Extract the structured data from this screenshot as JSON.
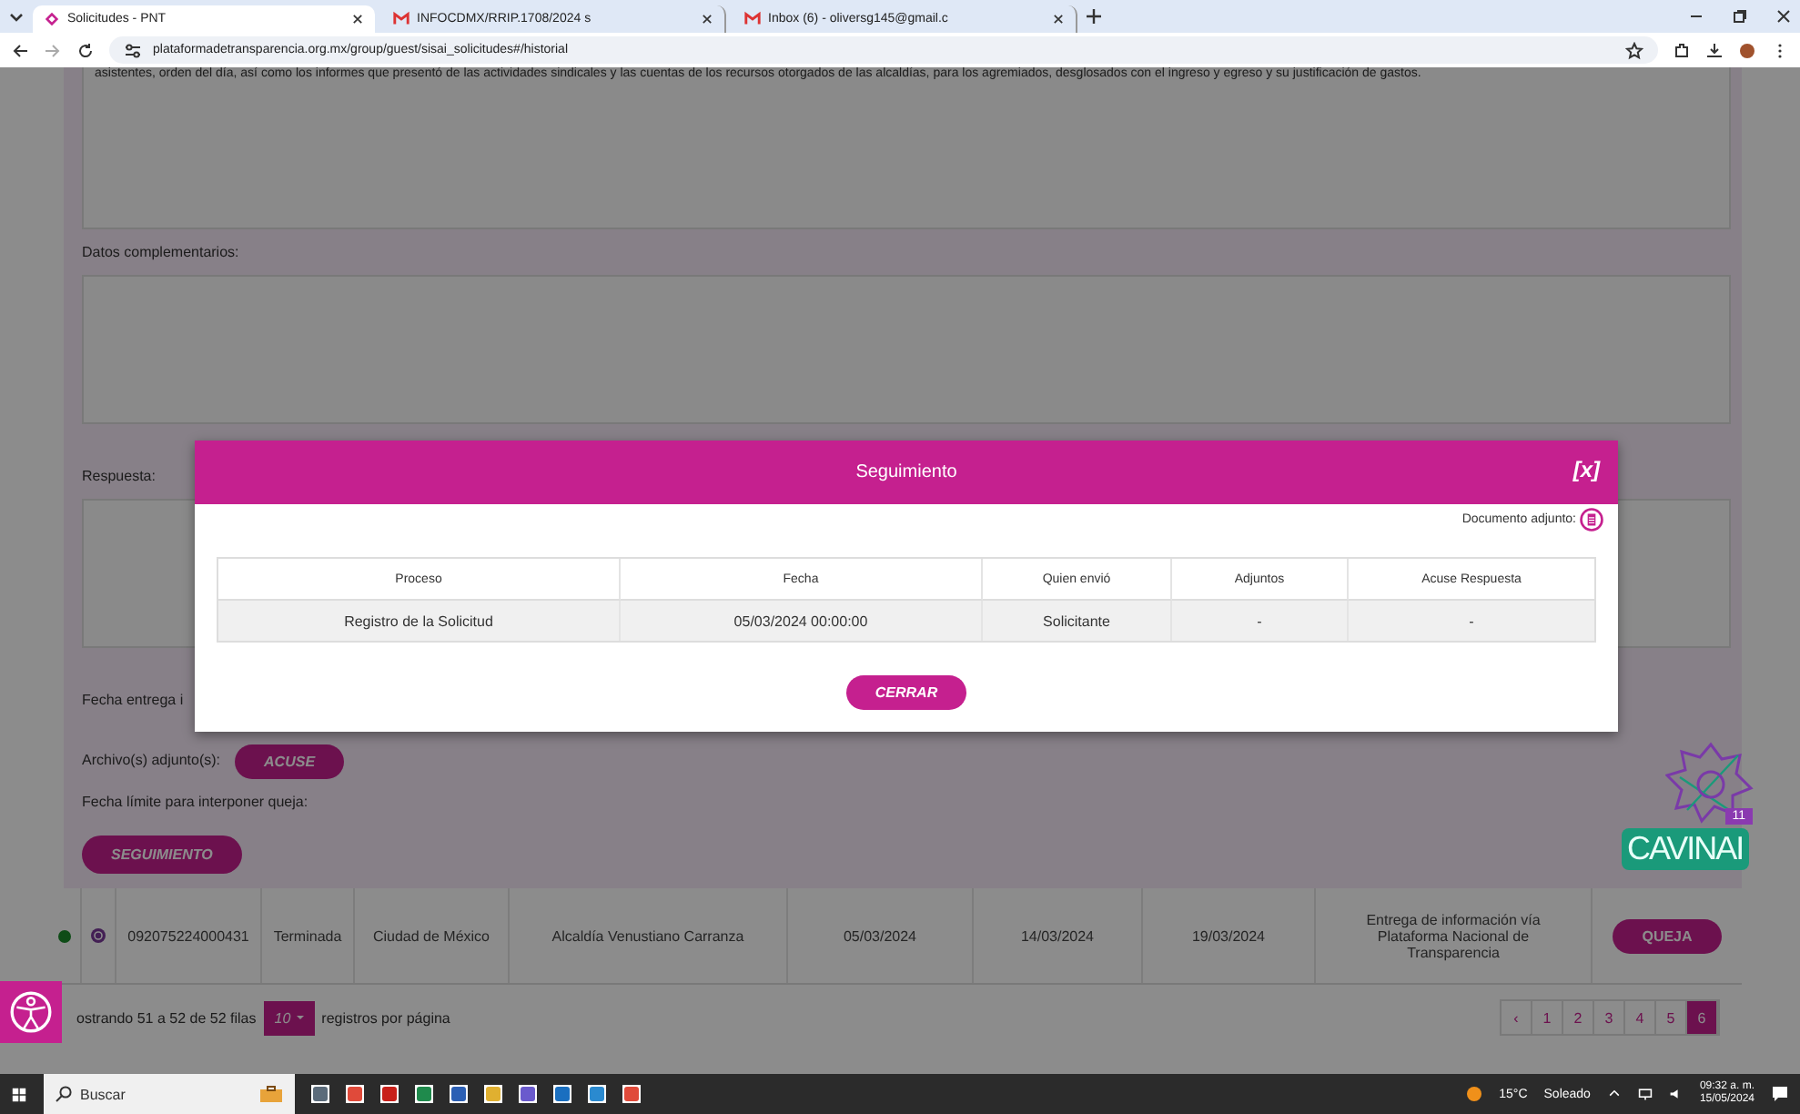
{
  "browser": {
    "tabs": [
      {
        "title": "Solicitudes - PNT",
        "selected": true
      },
      {
        "title": "INFOCDMX/RRIP.1708/2024 s",
        "selected": false
      },
      {
        "title": "Inbox (6) - oliversg145@gmail.c",
        "selected": false
      }
    ],
    "address": "plataformadetransparencia.org.mx/group/guest/sisai_solicitudes#/historial"
  },
  "form": {
    "top_text": "asistentes, orden del día, así como los informes que presentó de las actividades sindicales y las cuentas de los recursos otorgados de las alcaldías, para los agremiados, desglosados con el ingreso y egreso y su justificación de gastos.",
    "sections": [
      {
        "label": "Datos complementarios:"
      },
      {
        "label": "Respuesta:"
      }
    ],
    "delivery_label": "Fecha entrega i",
    "attachments_label": "Archivo(s) adjunto(s):",
    "attachments_button": "ACUSE",
    "deadline_label": "Fecha límite para interponer queja:",
    "followup_button": "SEGUIMIENTO"
  },
  "row": {
    "cells": [
      "092075224000431",
      "Terminada",
      "Ciudad de México",
      "Alcaldía Venustiano Carranza",
      "05/03/2024",
      "14/03/2024",
      "19/03/2024",
      "Entrega de información vía Plataforma Nacional de Transparencia"
    ],
    "button": "QUEJA"
  },
  "footer": {
    "showing": "ostrando 51 a 52 de 52 filas",
    "page_size": "10",
    "per_page": "registros por página",
    "pages": [
      {
        "label": "‹",
        "selected": false
      },
      {
        "label": "1",
        "selected": false
      },
      {
        "label": "2",
        "selected": false
      },
      {
        "label": "3",
        "selected": false
      },
      {
        "label": "4",
        "selected": false
      },
      {
        "label": "5",
        "selected": false
      },
      {
        "label": "6",
        "selected": true
      }
    ]
  },
  "modal": {
    "title": "Seguimiento",
    "close": "[x]",
    "attachment_label": "Documento adjunto:",
    "columns": [
      "Proceso",
      "Fecha",
      "Quien envió",
      "Adjuntos",
      "Acuse Respuesta"
    ],
    "rows": [
      [
        "Registro de la Solicitud",
        "05/03/2024 00:00:00",
        "Solicitante",
        "-",
        "-"
      ]
    ],
    "button": "CERRAR"
  },
  "widget": {
    "badge": "11",
    "name": "CAVINAI"
  },
  "taskbar": {
    "search_placeholder": "Buscar",
    "temperature": "15°C",
    "weather": "Soleado",
    "time": "09:32 a. m.",
    "date": "15/05/2024"
  }
}
